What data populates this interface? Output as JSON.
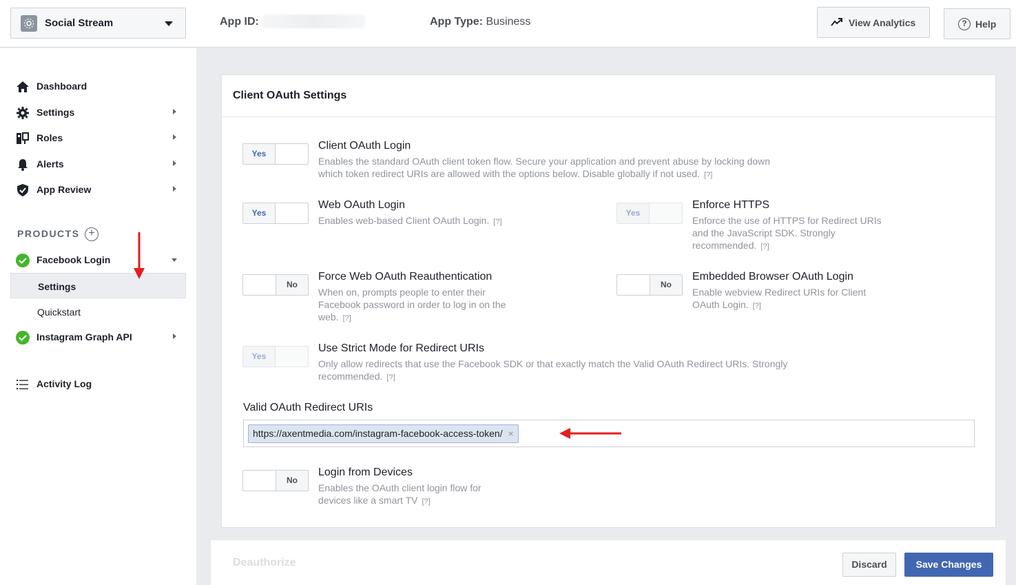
{
  "topbar": {
    "app_name": "Social Stream",
    "app_id_label": "App ID:",
    "app_type_label": "App Type:",
    "app_type_value": "Business",
    "view_analytics_label": "View Analytics",
    "help_label": "Help",
    "help_icon_glyph": "?"
  },
  "sidebar": {
    "items": [
      {
        "label": "Dashboard",
        "icon": "home-icon"
      },
      {
        "label": "Settings",
        "icon": "gear-icon"
      },
      {
        "label": "Roles",
        "icon": "roles-icon"
      },
      {
        "label": "Alerts",
        "icon": "bell-icon"
      },
      {
        "label": "App Review",
        "icon": "shield-icon"
      }
    ],
    "products_label": "PRODUCTS",
    "products_plus": "+",
    "facebook_login": {
      "label": "Facebook Login",
      "sub_items": [
        "Settings",
        "Quickstart"
      ]
    },
    "instagram_label": "Instagram Graph API",
    "activity_log_label": "Activity Log"
  },
  "card": {
    "title": "Client OAuth Settings",
    "help_marker": "[?]",
    "options": {
      "client_oauth": {
        "title": "Client OAuth Login",
        "desc_1": "Enables the standard OAuth client token flow. Secure your application and prevent abuse by locking down",
        "desc_2": "which token redirect URIs are allowed with the options below. Disable globally if not used.",
        "state": "Yes"
      },
      "web_oauth": {
        "title": "Web OAuth Login",
        "desc_1": "Enables web-based Client OAuth Login.",
        "state": "Yes"
      },
      "enforce_https": {
        "title": "Enforce HTTPS",
        "desc_1": "Enforce the use of HTTPS for Redirect URIs",
        "desc_2": "and the JavaScript SDK. Strongly",
        "desc_3": "recommended.",
        "state": "Yes"
      },
      "force_reauth": {
        "title": "Force Web OAuth Reauthentication",
        "desc_1": "When on, prompts people to enter their",
        "desc_2": "Facebook password in order to log in on the",
        "desc_3": "web.",
        "state": "No"
      },
      "embedded_browser": {
        "title": "Embedded Browser OAuth Login",
        "desc_1": "Enable webview Redirect URIs for Client",
        "desc_2": "OAuth Login.",
        "state": "No"
      },
      "strict_mode": {
        "title": "Use Strict Mode for Redirect URIs",
        "desc_1": "Only allow redirects that use the Facebook SDK or that exactly match the Valid OAuth Redirect URIs. Strongly",
        "desc_2": "recommended.",
        "state": "Yes"
      },
      "login_devices": {
        "title": "Login from Devices",
        "desc_1": "Enables the OAuth client login flow for",
        "desc_2": "devices like a smart TV",
        "state": "No"
      }
    },
    "redirect_uris_label": "Valid OAuth Redirect URIs",
    "redirect_uris": [
      "https://axentmedia.com/instagram-facebook-access-token/"
    ],
    "remove_glyph": "×"
  },
  "bottombar": {
    "deauthorize_label": "Deauthorize",
    "discard_label": "Discard",
    "save_label": "Save Changes"
  },
  "colors": {
    "accent": "#4267b2",
    "success": "#42b72a",
    "annotation": "#e41e1e"
  }
}
